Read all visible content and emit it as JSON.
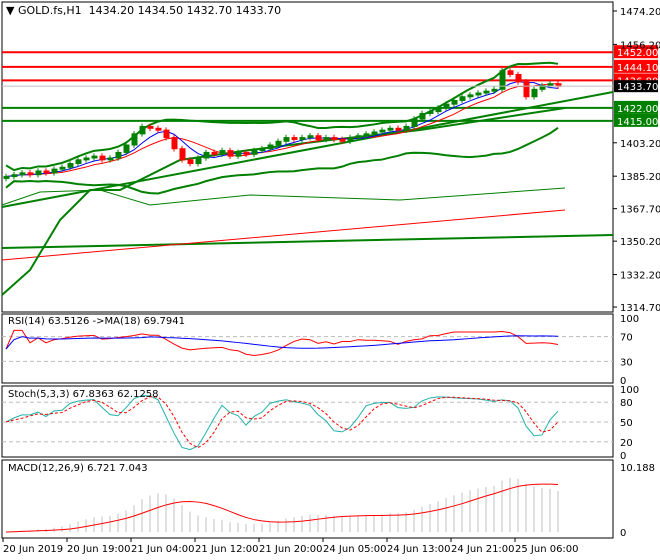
{
  "header": {
    "symbol": "GOLD.fs,H1",
    "ohlc": "1434.20 1434.50 1432.70 1433.70"
  },
  "price_axis": [
    "1474.20",
    "1456.20",
    "1403.20",
    "1385.20",
    "1367.70",
    "1350.20",
    "1332.20",
    "1314.70"
  ],
  "current_price": "1433.70",
  "levels": [
    {
      "label": "1452.00",
      "value": 1452.0,
      "color": "#ff0000"
    },
    {
      "label": "1444.10",
      "value": 1444.1,
      "color": "#ff0000"
    },
    {
      "label": "1436.80",
      "value": 1436.8,
      "color": "#ff0000"
    },
    {
      "label": "1422.00",
      "value": 1422.0,
      "color": "#008000"
    },
    {
      "label": "1415.00",
      "value": 1415.0,
      "color": "#008000"
    }
  ],
  "rsi": {
    "label": "RSI(14) 63.5126  ->MA(18) 69.7941",
    "axis": [
      "100",
      "70",
      "30",
      "0"
    ]
  },
  "stoch": {
    "label": "Stoch(5,3,3) 67.8363 62.1258",
    "axis": [
      "100",
      "80",
      "50",
      "20",
      "0"
    ]
  },
  "macd": {
    "label": "MACD(12,26,9) 6.721 7.043",
    "axis": [
      "10.188",
      "0"
    ]
  },
  "time_axis": [
    "20 Jun 2019",
    "20 Jun 19:00",
    "21 Jun 04:00",
    "21 Jun 12:00",
    "21 Jun 20:00",
    "24 Jun 05:00",
    "24 Jun 13:00",
    "24 Jun 21:00",
    "25 Jun 06:00"
  ],
  "chart_data": {
    "type": "line",
    "title": "GOLD.fs,H1",
    "ylim": [
      1314.7,
      1474.2
    ],
    "closes": [
      1385,
      1386,
      1387,
      1386,
      1388,
      1387,
      1389,
      1390,
      1392,
      1394,
      1395,
      1396,
      1394,
      1395,
      1398,
      1402,
      1408,
      1412,
      1411,
      1410,
      1406,
      1400,
      1394,
      1392,
      1395,
      1398,
      1397,
      1399,
      1396,
      1398,
      1397,
      1399,
      1400,
      1402,
      1404,
      1406,
      1405,
      1406,
      1407,
      1405,
      1406,
      1405,
      1404,
      1406,
      1407,
      1408,
      1409,
      1410,
      1411,
      1410,
      1412,
      1416,
      1419,
      1420,
      1422,
      1424,
      1426,
      1428,
      1429,
      1430,
      1431,
      1432,
      1442,
      1440,
      1436,
      1428,
      1432,
      1434,
      1435,
      1433.7
    ]
  }
}
